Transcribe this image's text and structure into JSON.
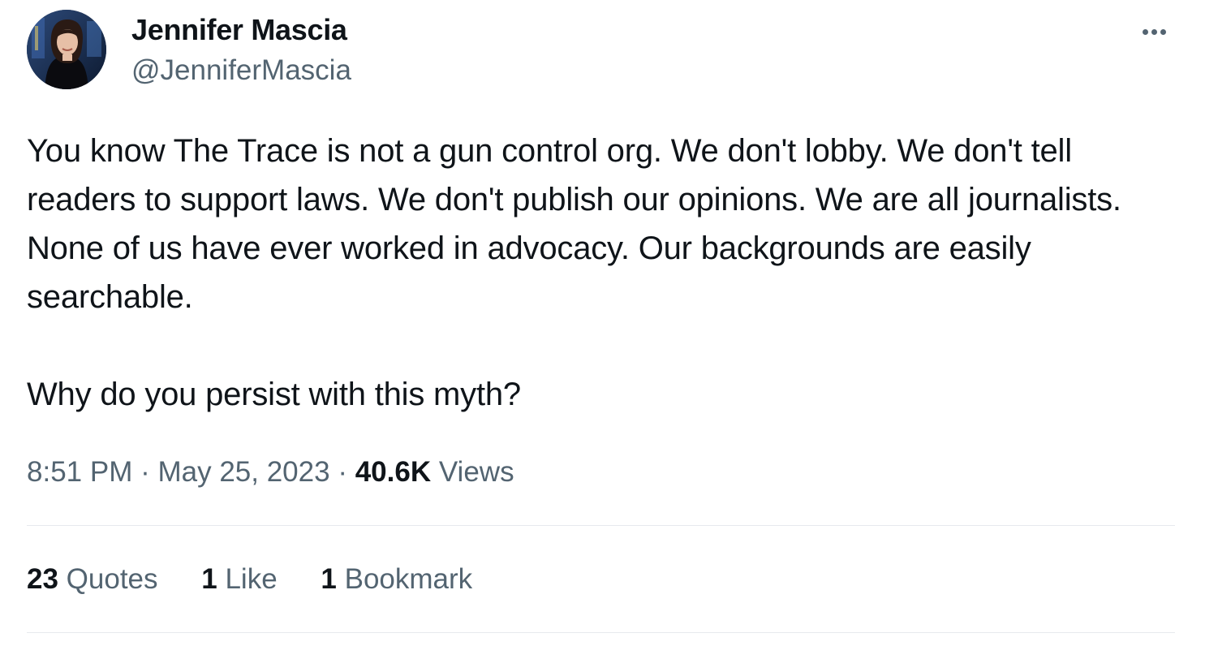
{
  "author": {
    "display_name": "Jennifer Mascia",
    "handle": "@JenniferMascia",
    "avatar_icon": "profile-photo"
  },
  "more_icon": "more-horizontal-icon",
  "tweet": {
    "paragraphs": [
      "You know The Trace is not a gun control org. We don't lobby. We don't tell readers to support laws. We don't publish our opinions. We are all journalists. None of us have ever worked in advocacy. Our backgrounds are easily searchable.",
      "Why do you persist with this myth?"
    ]
  },
  "meta": {
    "time": "8:51 PM",
    "separator": "·",
    "date": "May 25, 2023",
    "views_count": "40.6K",
    "views_label": "Views"
  },
  "stats": {
    "quotes_count": "23",
    "quotes_label": "Quotes",
    "likes_count": "1",
    "likes_label": "Like",
    "bookmarks_count": "1",
    "bookmarks_label": "Bookmark"
  },
  "colors": {
    "text_primary": "#0f1419",
    "text_secondary": "#536471",
    "divider": "#e7e9ee",
    "background": "#ffffff"
  }
}
